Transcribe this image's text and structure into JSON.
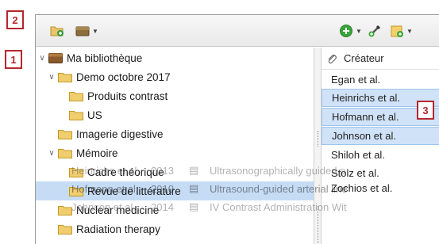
{
  "callouts": [
    "1",
    "2",
    "3"
  ],
  "toolbar": {
    "left_buttons": [
      "new-collection-icon",
      "new-group-icon"
    ],
    "right_buttons": [
      "new-item-icon",
      "add-by-identifier-icon",
      "new-note-icon"
    ]
  },
  "tree": {
    "items": [
      {
        "label": "Ma bibliothèque",
        "level": 0,
        "expanded": true,
        "icon": "library-icon"
      },
      {
        "label": "Demo octobre 2017",
        "level": 1,
        "expanded": true,
        "icon": "folder-icon"
      },
      {
        "label": "Produits contrast",
        "level": 2,
        "icon": "folder-icon"
      },
      {
        "label": "US",
        "level": 2,
        "icon": "folder-icon"
      },
      {
        "label": "Imagerie digestive",
        "level": 1,
        "icon": "folder-icon"
      },
      {
        "label": "Mémoire",
        "level": 1,
        "expanded": true,
        "icon": "folder-icon"
      },
      {
        "label": "Cadre théorique",
        "level": 2,
        "icon": "folder-icon"
      },
      {
        "label": "Revue de littérature",
        "level": 2,
        "icon": "folder-icon",
        "selected": true
      },
      {
        "label": "Nuclear medicine",
        "level": 1,
        "icon": "folder-icon"
      },
      {
        "label": "Radiation therapy",
        "level": 1,
        "icon": "folder-icon"
      }
    ]
  },
  "items_pane": {
    "column_header": "Créateur",
    "rows": [
      {
        "label": "Egan et al.",
        "selected": false
      },
      {
        "label": "Heinrichs et al.",
        "selected": true
      },
      {
        "label": "Hofmann et al.",
        "selected": true
      },
      {
        "label": "Johnson et al.",
        "selected": true
      },
      {
        "label": "Shiloh et al.",
        "selected": false
      },
      {
        "label": "Stolz et al.",
        "selected": false
      },
      {
        "label": "Zochios et al.",
        "selected": false
      }
    ]
  },
  "drag_ghost": {
    "rows": [
      {
        "author": "Heinrichs et al.",
        "year": "2013",
        "title": "Ultrasonographically guided p"
      },
      {
        "author": "Hofmann et al.",
        "year": "2010",
        "title": "Ultrasound-guided arterial line"
      },
      {
        "author": "Johnson et al.",
        "year": "2014",
        "title": "IV Contrast Administration Wit"
      }
    ]
  },
  "colors": {
    "callout_border": "#b5272d",
    "selection": "#c6dcf5",
    "folder": "#e9c46a"
  }
}
